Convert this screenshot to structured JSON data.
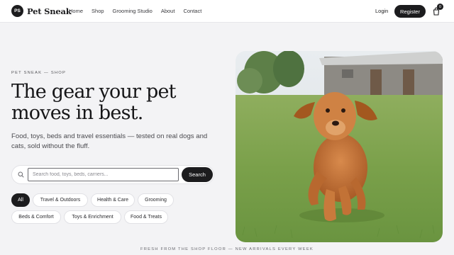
{
  "header": {
    "logo_mark": "PS",
    "brand": "Pet Sneak",
    "nav": [
      "Home",
      "Shop",
      "Grooming Studio",
      "About",
      "Contact"
    ],
    "login": "Login",
    "register": "Register",
    "cart_count": "0",
    "cart_icon": "shopping-bag-icon"
  },
  "hero": {
    "eyebrow": "PET SNEAK — SHOP",
    "headline_line1": "The gear your pet",
    "headline_line2": "moves in best.",
    "subtext": "Food, toys, beds and travel essentials — tested on real dogs and cats, sold without the fluff.",
    "image": "golden-retriever-puppy-running-on-grass"
  },
  "search": {
    "icon": "search-icon",
    "placeholder": "Search food, toys, beds, carriers...",
    "button": "Search"
  },
  "categories": [
    {
      "label": "All",
      "active": true
    },
    {
      "label": "Travel & Outdoors",
      "active": false
    },
    {
      "label": "Health & Care",
      "active": false
    },
    {
      "label": "Grooming",
      "active": false
    },
    {
      "label": "Beds & Comfort",
      "active": false
    },
    {
      "label": "Toys & Enrichment",
      "active": false
    },
    {
      "label": "Food & Treats",
      "active": false
    }
  ],
  "footer_strip": "FRESH FROM THE SHOP FLOOR — NEW ARRIVALS EVERY WEEK",
  "colors": {
    "accent": "#1c1c1e",
    "background": "#f3f3f5"
  }
}
